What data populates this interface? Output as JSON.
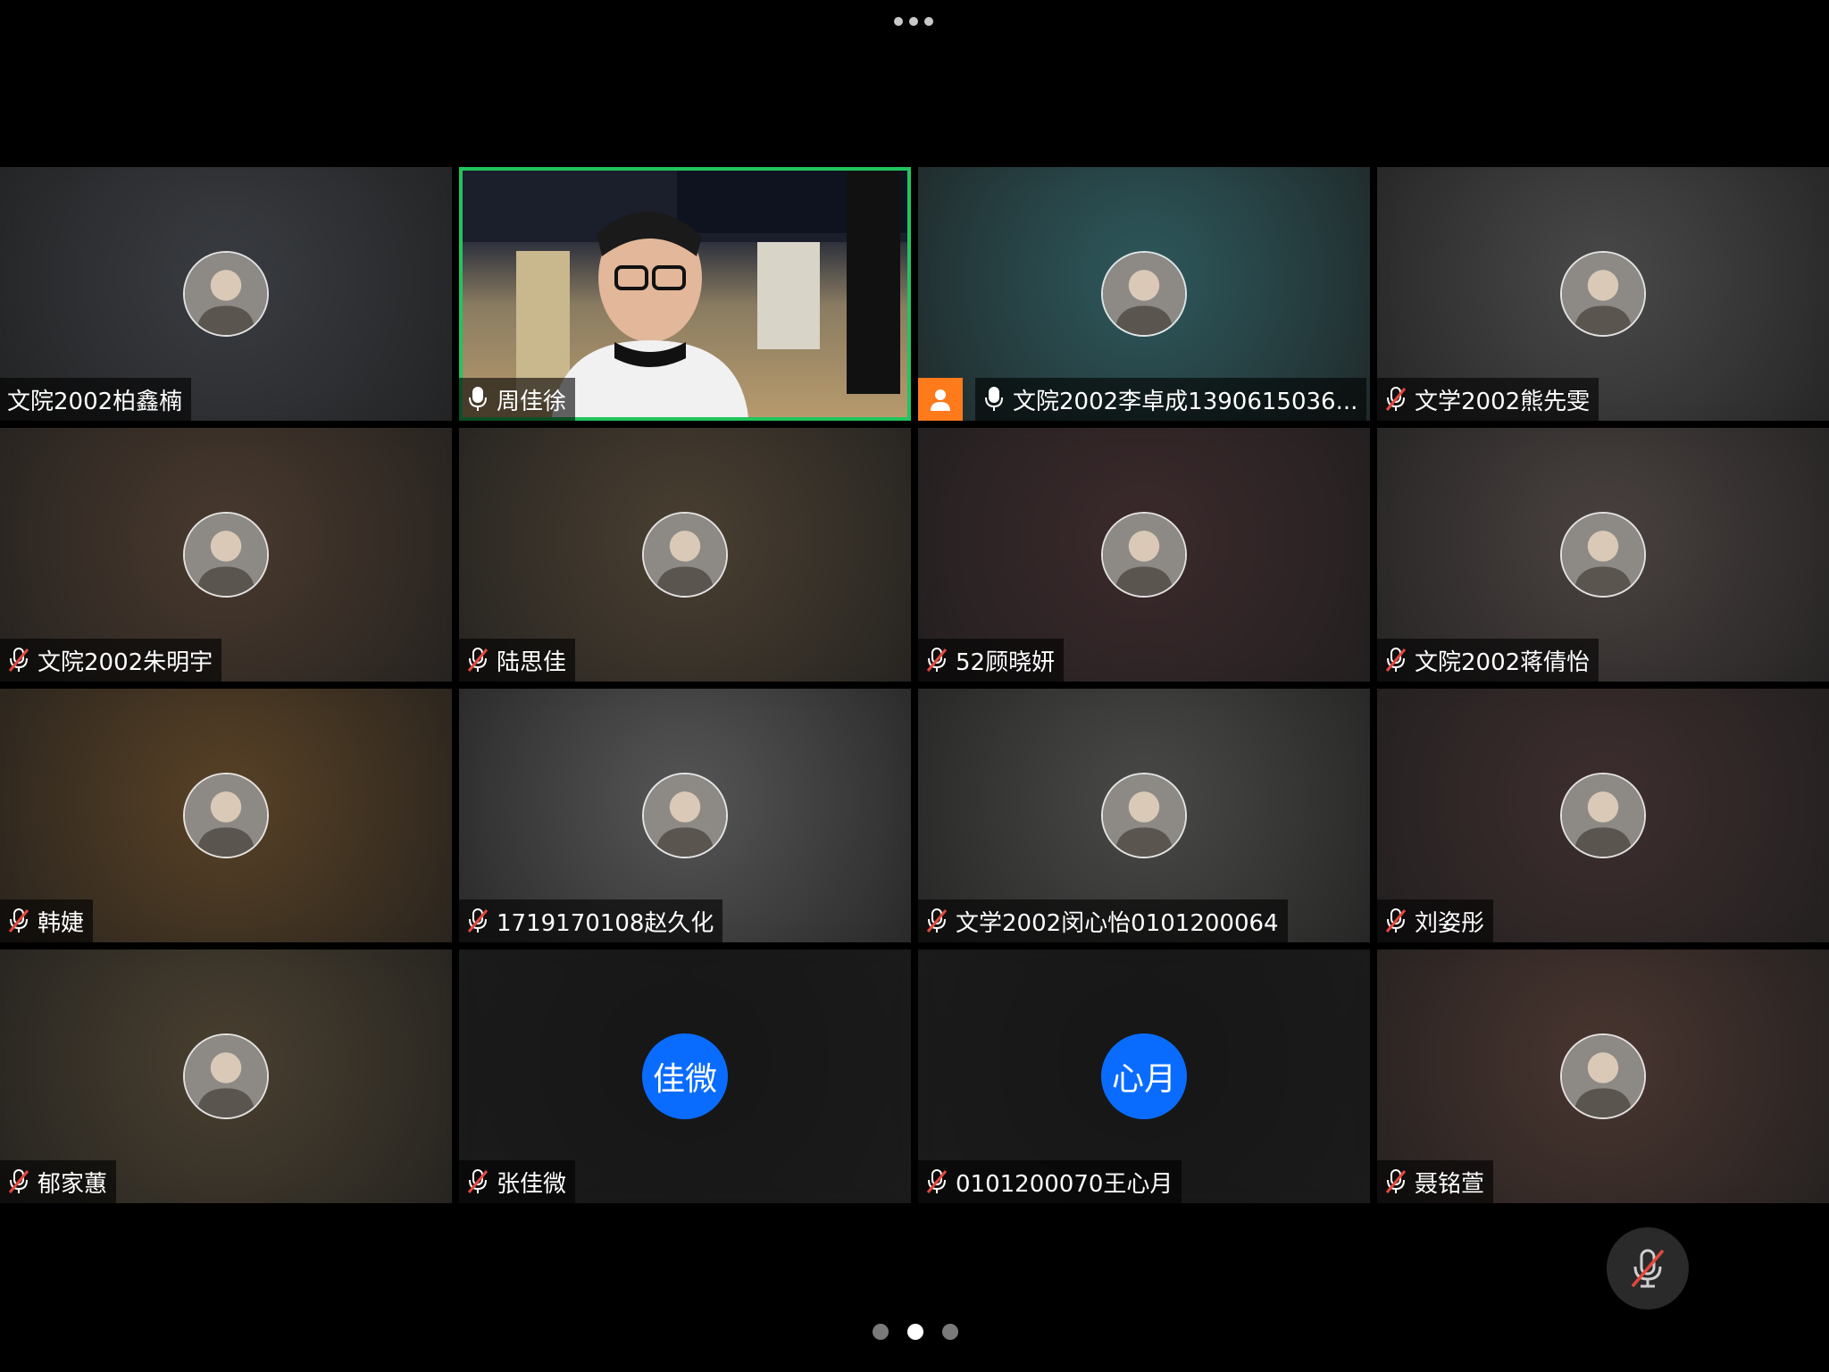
{
  "toolbar": {
    "more_icon": "more-horizontal-icon"
  },
  "tiles": [
    {
      "name": "文院2002柏鑫楠",
      "mic": "none",
      "avatar_icon": "user-photo-avatar",
      "bg": "#3a3d42"
    },
    {
      "name": "周佳徐",
      "mic": "on",
      "video": true,
      "active": true,
      "active_color": "#22c55e"
    },
    {
      "name": "文院2002李卓成1390615036...",
      "mic": "on",
      "avatar_icon": "anime-girl-avatar",
      "host_badge": "person-icon",
      "bg": "#2e5a5e"
    },
    {
      "name": "文学2002熊先雯",
      "mic": "muted",
      "avatar_icon": "drawn-character-avatar",
      "bg": "#4a4a4a"
    },
    {
      "name": "文院2002朱明宇",
      "mic": "muted",
      "avatar_icon": "plush-toy-avatar",
      "bg": "#4a3a2e"
    },
    {
      "name": "陆思佳",
      "mic": "muted",
      "avatar_icon": "dog-avatar",
      "bg": "#4b4032"
    },
    {
      "name": "52顾晓妍",
      "mic": "muted",
      "avatar_icon": "person-photo-avatar",
      "bg": "#3c2a2c"
    },
    {
      "name": "文院2002蒋倩怡",
      "mic": "muted",
      "avatar_icon": "plush-cat-avatar",
      "bg": "#4a4240"
    },
    {
      "name": "韩婕",
      "mic": "muted",
      "avatar_icon": "cat-avatar",
      "bg": "#5a4226"
    },
    {
      "name": "1719170108赵久化",
      "mic": "muted",
      "avatar_icon": "cartoon-face-avatar",
      "bg": "#575757"
    },
    {
      "name": "文学2002闵心怡0101200064",
      "mic": "muted",
      "avatar_icon": "anime-boy-avatar",
      "bg": "#4a4a48"
    },
    {
      "name": "刘姿彤",
      "mic": "muted",
      "avatar_icon": "selfie-avatar",
      "bg": "#3e2e2e"
    },
    {
      "name": "郁家蕙",
      "mic": "muted",
      "avatar_icon": "shiba-avatar",
      "bg": "#4a4030"
    },
    {
      "name": "张佳微",
      "mic": "muted",
      "initials": "佳微",
      "bg": "#161616"
    },
    {
      "name": "0101200070王心月",
      "mic": "muted",
      "initials": "心月",
      "bg": "#161616"
    },
    {
      "name": "聂铭萱",
      "mic": "muted",
      "avatar_icon": "illustrated-girl-avatar",
      "bg": "#4a3630"
    }
  ],
  "controls": {
    "mute_icon": "mic-off-icon"
  },
  "pagination": {
    "pages": 3,
    "current": 2
  },
  "colors": {
    "muted_red": "#e5483d",
    "initials_blue": "#0a6cff",
    "host_orange": "#ff7a1a"
  }
}
